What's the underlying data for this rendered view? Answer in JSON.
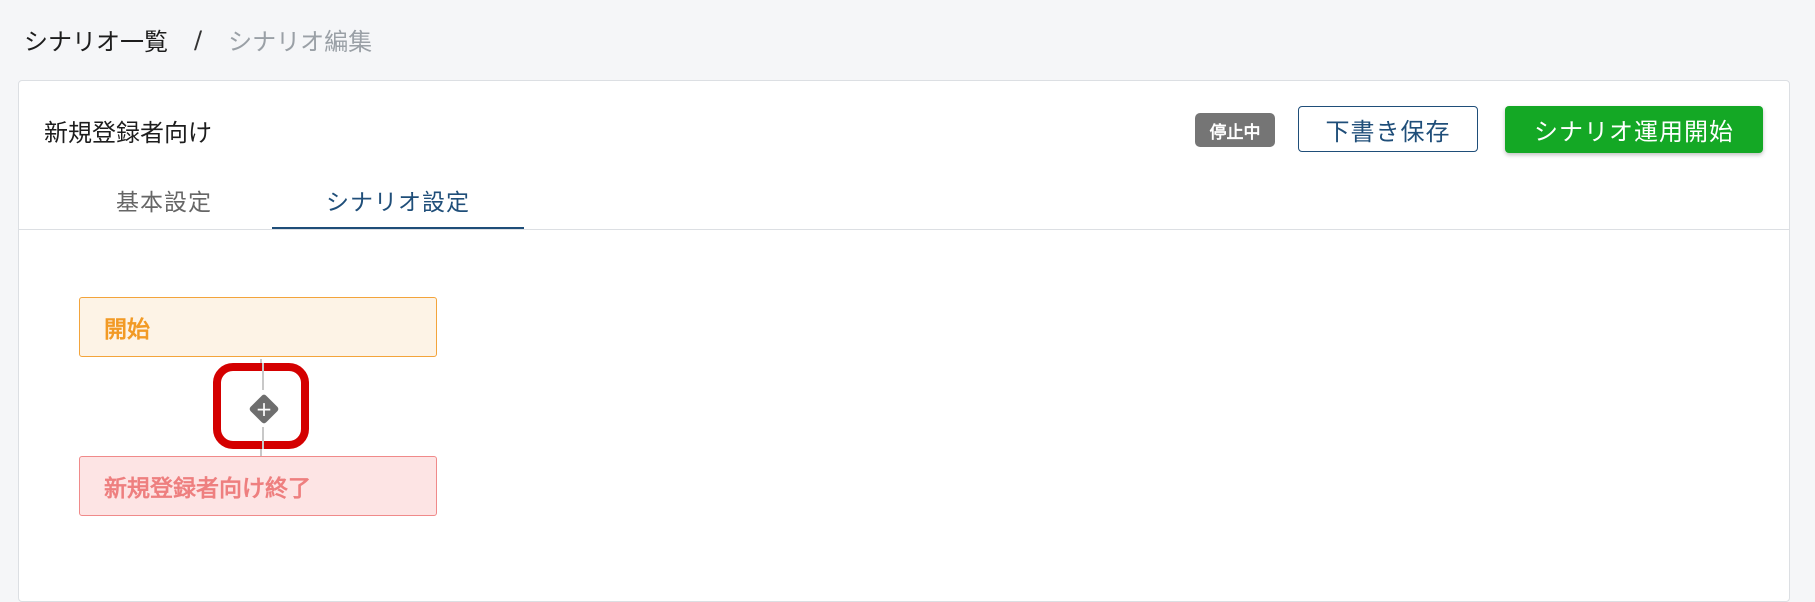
{
  "breadcrumb": {
    "root": "シナリオ一覧",
    "separator": "/",
    "current": "シナリオ編集"
  },
  "header": {
    "scenario_name": "新規登録者向け",
    "status_badge": "停止中",
    "draft_save_label": "下書き保存",
    "start_label": "シナリオ運用開始"
  },
  "tabs": [
    {
      "label": "基本設定",
      "active": false
    },
    {
      "label": "シナリオ設定",
      "active": true
    }
  ],
  "flow": {
    "start_node": "開始",
    "add_icon": "plus-icon",
    "add_symbol": "+",
    "end_node": "新規登録者向け終了"
  },
  "colors": {
    "accent": "#1f4e79",
    "start_button": "#14a825",
    "start_node": "#f29a25",
    "end_node": "#ee7f7f",
    "highlight": "#d40000"
  }
}
